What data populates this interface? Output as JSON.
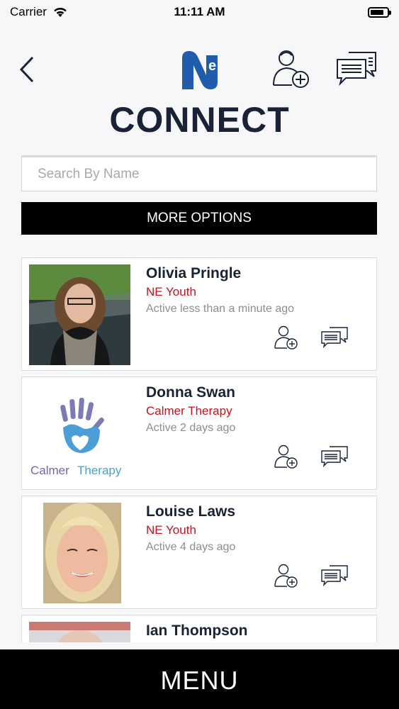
{
  "status_bar": {
    "carrier": "Carrier",
    "time": "11:11 AM",
    "battery_level": 0.8
  },
  "header": {
    "logo_letters": "NE",
    "back_icon": "chevron-left-icon",
    "add_user_icon": "add-user-icon",
    "messages_icon": "chat-bubbles-icon"
  },
  "page_title": "CONNECT",
  "search": {
    "placeholder": "Search By Name",
    "value": ""
  },
  "more_options_label": "MORE OPTIONS",
  "contacts": [
    {
      "name": "Olivia Pringle",
      "org": "NE Youth",
      "active": "Active less than a minute ago"
    },
    {
      "name": "Donna Swan",
      "org": "Calmer Therapy",
      "active": "Active 2 days ago",
      "logo_text_1": "Calmer",
      "logo_text_2": "Therapy"
    },
    {
      "name": "Louise Laws",
      "org": "NE Youth",
      "active": "Active 4 days ago"
    },
    {
      "name": "Ian Thompson",
      "org": "",
      "active": ""
    }
  ],
  "menu_label": "MENU",
  "colors": {
    "navy": "#1a2238",
    "accent_red": "#c8101c",
    "logo_blue": "#1f5cab",
    "menu_bg": "#000000"
  }
}
